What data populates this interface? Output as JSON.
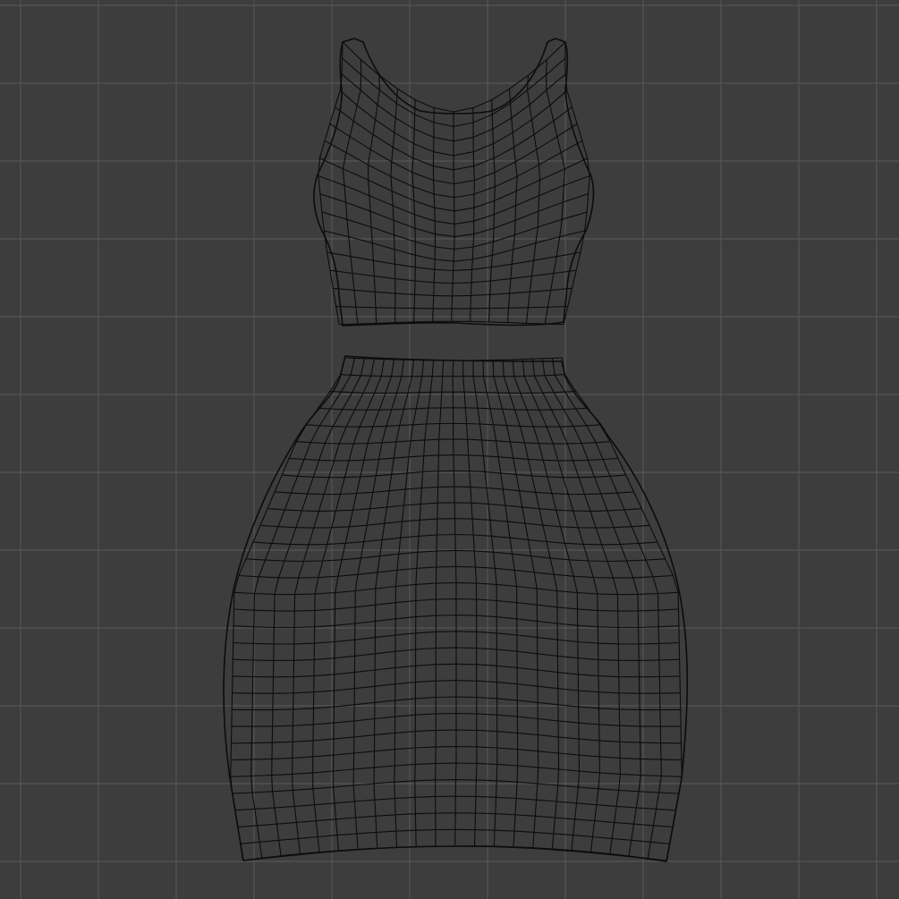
{
  "viewport": {
    "background_color": "#3d3d3d",
    "grid_line_color": "#555555",
    "wire_color": "#0c0c0c",
    "objects": [
      {
        "name": "crop-top",
        "type": "wireframe-mesh"
      },
      {
        "name": "skirt",
        "type": "wireframe-mesh"
      }
    ]
  }
}
